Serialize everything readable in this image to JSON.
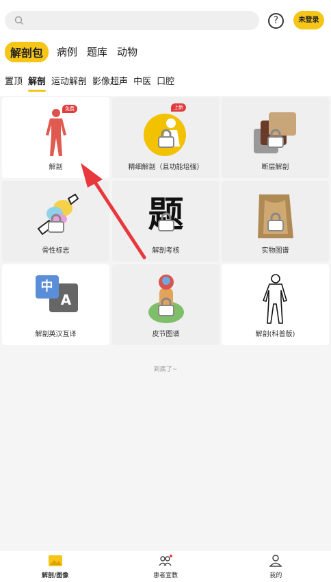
{
  "header": {
    "help_label": "?",
    "login_label": "未登录"
  },
  "main_tabs": [
    "解剖包",
    "病例",
    "题库",
    "动物"
  ],
  "sub_tabs": [
    "置顶",
    "解剖",
    "运动解剖",
    "影像超声",
    "中医",
    "口腔"
  ],
  "cards": [
    {
      "label": "解剖",
      "badge": "免费"
    },
    {
      "label": "精细解剖（且功能培强）",
      "badge": "上新"
    },
    {
      "label": "断层解剖"
    },
    {
      "label": "骨性标志"
    },
    {
      "label": "解剖考核",
      "icon_text": "题"
    },
    {
      "label": "实物图谱"
    },
    {
      "label": "解剖英汉互译",
      "icon_text_zh": "中",
      "icon_text_en": "A"
    },
    {
      "label": "皮节图谱"
    },
    {
      "label": "解剖(科普版)"
    }
  ],
  "end_text": "到底了~",
  "nav": [
    {
      "label": "解剖/图像"
    },
    {
      "label": "患者宣教"
    },
    {
      "label": "我的"
    }
  ],
  "colors": {
    "accent": "#f5c518",
    "badge": "#e03c3c",
    "arrow": "#e8383d"
  }
}
